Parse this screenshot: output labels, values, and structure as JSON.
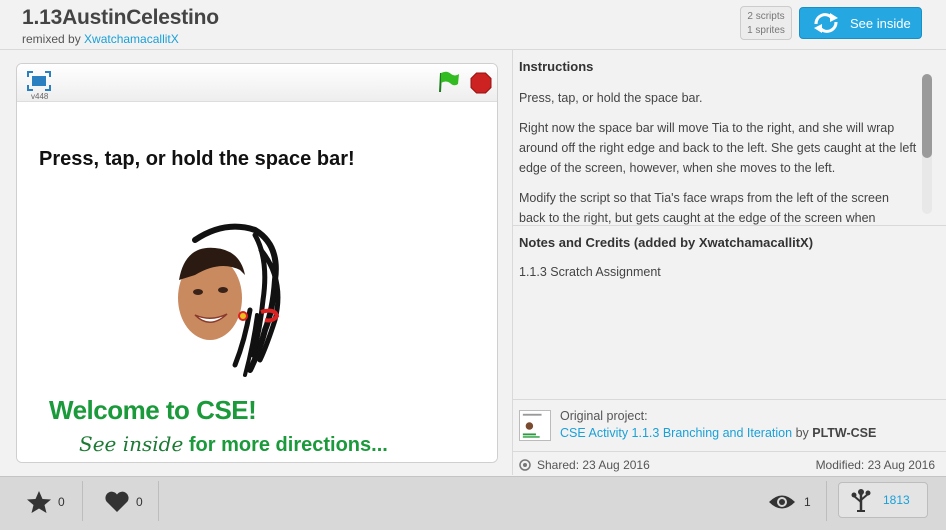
{
  "header": {
    "title": "1.13AustinCelestino",
    "remixed_by_prefix": "remixed by",
    "remixed_by_user": "XwatchamacallitX",
    "scripts_count": "2 scripts",
    "sprites_count": "1 sprites",
    "see_inside_label": "See inside"
  },
  "player": {
    "version": "v448",
    "stage_heading": "Press, tap, or hold the space bar!",
    "welcome_text": "Welcome to CSE!",
    "directions_hand": "See inside",
    "directions_rest": "for more directions...",
    "icons": [
      "fullscreen-icon",
      "green-flag-icon",
      "stop-icon"
    ]
  },
  "instructions": {
    "title": "Instructions",
    "paragraphs": [
      "Press, tap, or hold the space bar.",
      "Right now the space bar will move Tia to the right, and she will wrap around off the right edge and back to the left. She gets caught at the left edge of the screen, however, when she moves to the left.",
      "Modify the script so that Tia's face wraps from the left of the screen back to the right, but gets caught at the edge of the screen when"
    ]
  },
  "notes": {
    "title": "Notes and Credits (added by XwatchamacallitX)",
    "body": "1.1.3 Scratch Assignment"
  },
  "original": {
    "label": "Original project:",
    "project_link": "CSE Activity 1.1.3 Branching and Iteration",
    "by_text": "by",
    "author": "PLTW-CSE"
  },
  "dates": {
    "shared": "Shared: 23 Aug 2016",
    "modified": "Modified: 23 Aug 2016"
  },
  "footer": {
    "favorites": "0",
    "loves": "0",
    "views": "1",
    "remixes": "1813"
  },
  "colors": {
    "accent": "#25a7e2",
    "link": "#1aa0d8",
    "stage_text_green": "#1a9a3a"
  }
}
